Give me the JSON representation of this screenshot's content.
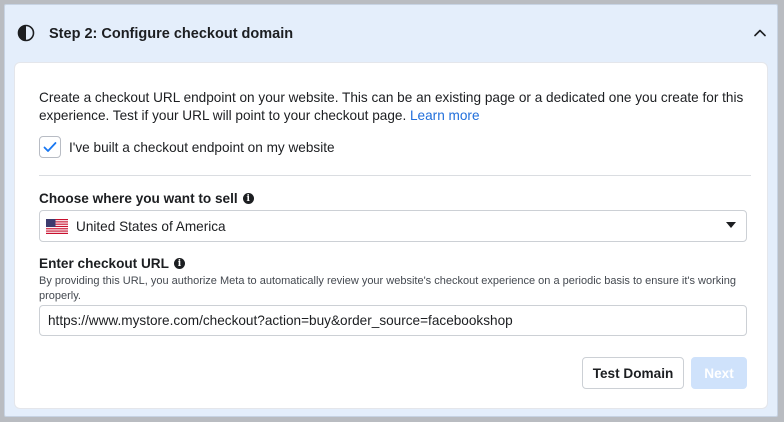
{
  "header": {
    "title": "Step 2: Configure checkout domain",
    "step_icon": "half-circle-icon",
    "collapse_icon": "chevron-up-icon"
  },
  "description": {
    "text": "Create a checkout URL endpoint on your website. This can be an existing page or a dedicated one you create for this experience. Test if your URL will point to your checkout page.",
    "learn_more": "Learn more"
  },
  "checkbox": {
    "label": "I've built a checkout endpoint on my website",
    "checked": true
  },
  "sell_location": {
    "label": "Choose where you want to sell",
    "selected": "United States of America",
    "flag_icon": "us-flag-icon"
  },
  "checkout_url": {
    "label": "Enter checkout URL",
    "help": "By providing this URL, you authorize Meta to automatically review your website's checkout experience on a periodic basis to ensure it's working properly.",
    "value": "https://www.mystore.com/checkout?action=buy&order_source=facebookshop"
  },
  "buttons": {
    "test": "Test Domain",
    "next": "Next"
  },
  "colors": {
    "accent_link": "#216fdb",
    "header_bg": "#e4eefb",
    "next_disabled_bg": "#cfe2fb"
  }
}
